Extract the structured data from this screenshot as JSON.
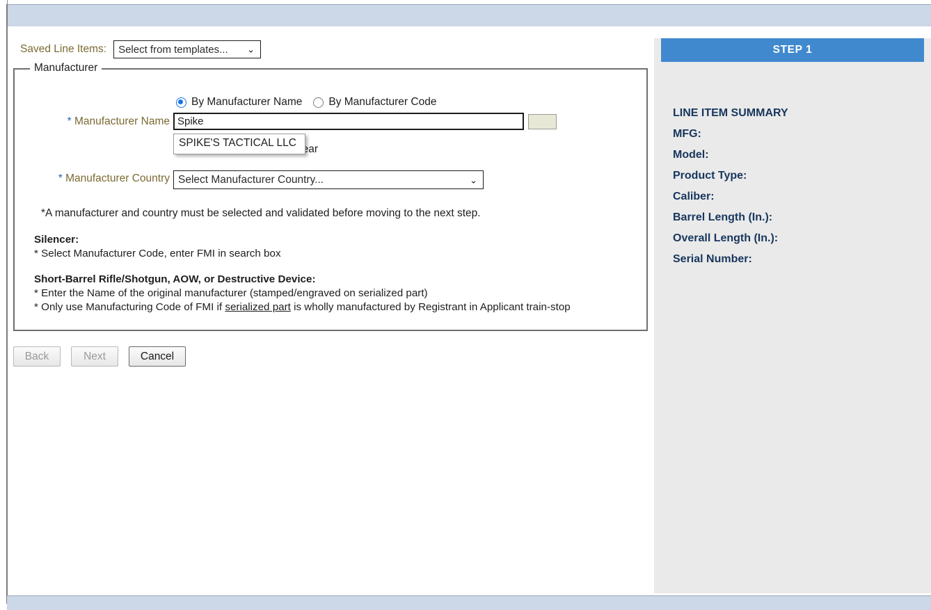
{
  "window": {
    "top_bar_color": "#ccd7e7",
    "bottom_bar_color": "#ccd7e7"
  },
  "form": {
    "saved_line_items": {
      "label": "Saved Line Items:",
      "select_value": "Select from templates...",
      "chevron": "⌄"
    },
    "fieldset_legend": "Manufacturer",
    "search_mode": {
      "option_name": "By Manufacturer Name",
      "option_code": "By Manufacturer Code",
      "selected": "By Manufacturer Name"
    },
    "manufacturer_name": {
      "asterisk": "*",
      "label": "Manufacturer Name",
      "value": "Spike",
      "placeholder": ""
    },
    "clear_link": "Clear",
    "autocomplete": {
      "visible": true,
      "items": [
        "SPIKE'S TACTICAL LLC"
      ]
    },
    "manufacturer_country": {
      "asterisk": "*",
      "label": "Manufacturer Country",
      "select_value": "Select Manufacturer Country...",
      "chevron": "⌄"
    },
    "required_note": "*A manufacturer and country must be selected and validated before moving to the next step.",
    "instructions": [
      {
        "heading": "Silencer:",
        "lines": [
          {
            "text": "* Select Manufacturer Code, enter FMI in search box",
            "underline_phrase": ""
          }
        ]
      },
      {
        "heading": "Short-Barrel Rifle/Shotgun, AOW, or Destructive Device:",
        "lines": [
          {
            "text": "* Enter the Name of the original manufacturer (stamped/engraved on serialized part)",
            "underline_phrase": ""
          },
          {
            "pre": "* Only use Manufacturing Code of FMI if ",
            "underline_phrase": "serialized part",
            "post": " is wholly manufactured by Registrant in Applicant train-stop"
          }
        ]
      }
    ]
  },
  "buttons": {
    "back": {
      "label": "Back",
      "enabled": false
    },
    "next": {
      "label": "Next",
      "enabled": false
    },
    "cancel": {
      "label": "Cancel",
      "enabled": true
    }
  },
  "summary": {
    "step_header": "STEP 1",
    "header_color": "#4189ce",
    "title": "LINE ITEM SUMMARY",
    "fields": [
      {
        "label": "MFG:",
        "value": ""
      },
      {
        "label": "Model:",
        "value": ""
      },
      {
        "label": "Product Type:",
        "value": ""
      },
      {
        "label": "Caliber:",
        "value": ""
      },
      {
        "label": "Barrel Length (In.):",
        "value": ""
      },
      {
        "label": "Overall Length (In.):",
        "value": ""
      },
      {
        "label": "Serial Number:",
        "value": ""
      }
    ]
  }
}
